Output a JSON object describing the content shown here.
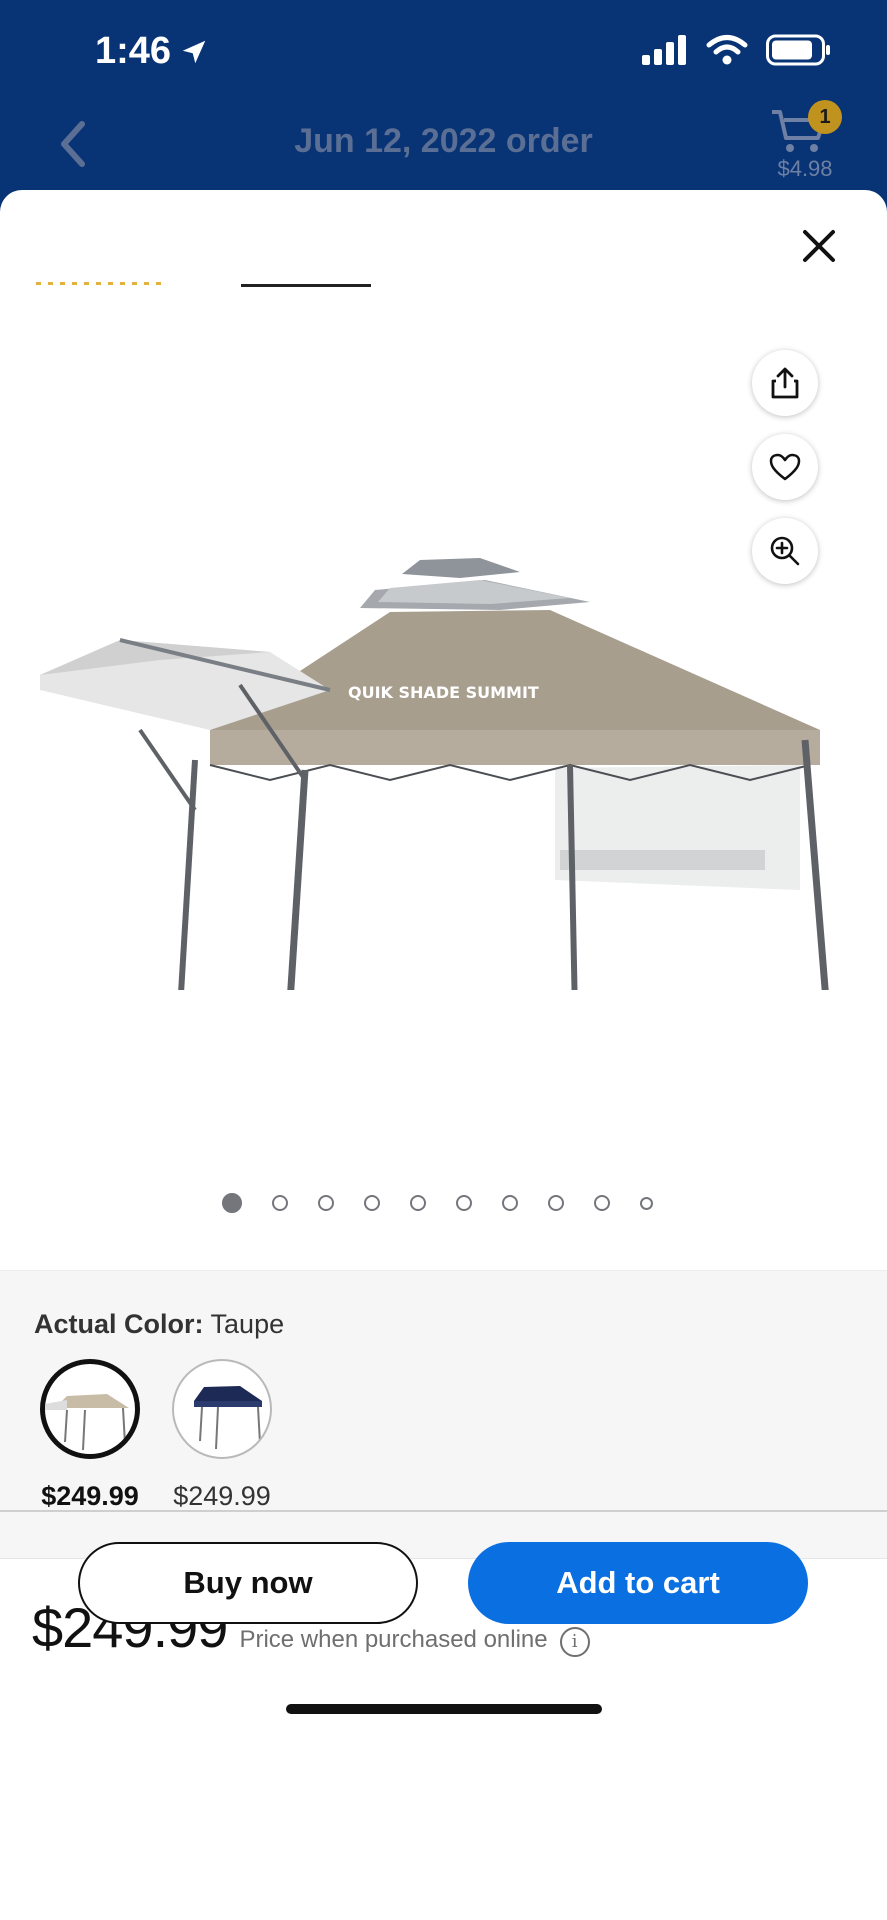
{
  "status_bar": {
    "time": "1:46"
  },
  "header": {
    "title": "Jun 12, 2022 order",
    "cart_count": "1",
    "cart_total": "$4.98"
  },
  "product": {
    "image_alt": "Quik Shade Summit canopy in taupe",
    "brand_print": "QUIK SHADE SUMMIT",
    "image_count": 10,
    "active_image": 1
  },
  "variant": {
    "color_label": "Actual Color:",
    "color_value": "Taupe",
    "options": [
      {
        "name": "Taupe",
        "price": "$249.99",
        "selected": true,
        "color": "#c9bca6"
      },
      {
        "name": "Navy",
        "price": "$249.99",
        "selected": false,
        "color": "#1c2a55"
      }
    ]
  },
  "pricing": {
    "price": "$249.99",
    "note": "Price when purchased online",
    "info_icon": "info-icon"
  },
  "actions": {
    "buy_now": "Buy now",
    "add_to_cart": "Add to cart"
  },
  "colors": {
    "header_bg": "#083476",
    "primary_button": "#0a6fe0",
    "cart_badge": "#c0931e"
  }
}
